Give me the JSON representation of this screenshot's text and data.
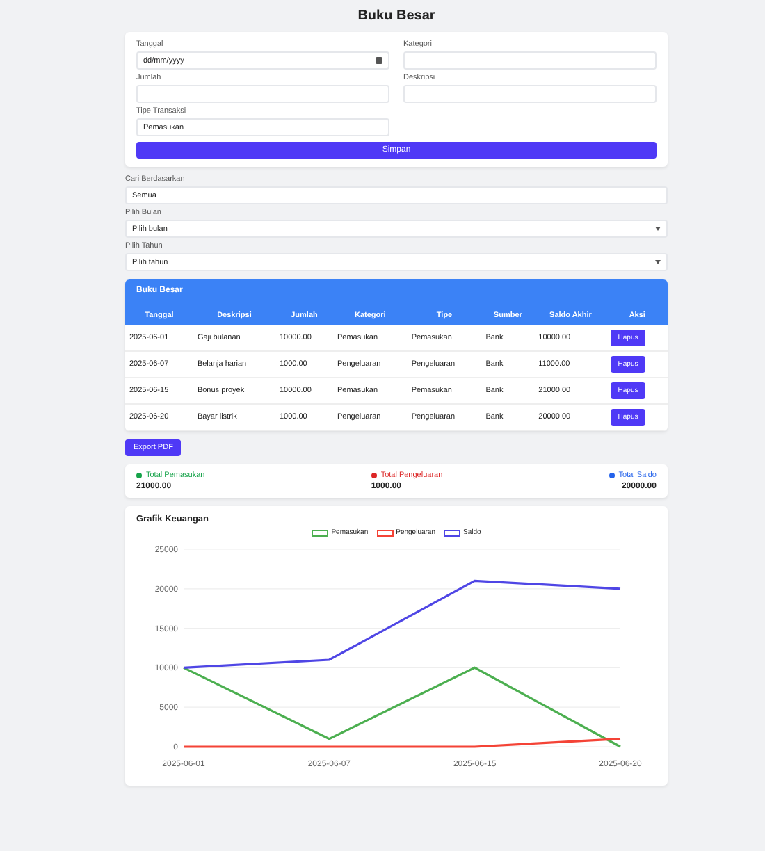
{
  "title": "Buku Besar",
  "form": {
    "fields": [
      {
        "label": "Tanggal",
        "value": "dd/mm/yyyy",
        "kind": "date"
      },
      {
        "label": "Kategori",
        "kind": "text"
      },
      {
        "label": "Jumlah",
        "kind": "text"
      },
      {
        "label": "Deskripsi",
        "kind": "text"
      },
      {
        "label": "Tipe Transaksi",
        "value": "Pemasukan",
        "kind": "select"
      }
    ],
    "submit": "Simpan"
  },
  "filters": [
    {
      "label": "Cari Berdasarkan",
      "value": "Semua",
      "kind": "text"
    },
    {
      "label": "Pilih Bulan",
      "value": "Pilih bulan",
      "kind": "select"
    },
    {
      "label": "Pilih Tahun",
      "value": "Pilih tahun",
      "kind": "select"
    }
  ],
  "ledger": {
    "title": "Buku Besar",
    "columns": [
      "Tanggal",
      "Deskripsi",
      "Jumlah",
      "Kategori",
      "Tipe",
      "Sumber",
      "Saldo Akhir",
      "Aksi"
    ],
    "rows": [
      {
        "cells": [
          "2025-06-01",
          "Gaji bulanan",
          "10000.00",
          "Pemasukan",
          "Pemasukan",
          "Bank",
          "10000.00"
        ],
        "action": "Hapus"
      },
      {
        "cells": [
          "2025-06-07",
          "Belanja harian",
          "1000.00",
          "Pengeluaran",
          "Pengeluaran",
          "Bank",
          "11000.00"
        ],
        "action": "Hapus"
      },
      {
        "cells": [
          "2025-06-15",
          "Bonus proyek",
          "10000.00",
          "Pemasukan",
          "Pemasukan",
          "Bank",
          "21000.00"
        ],
        "action": "Hapus"
      },
      {
        "cells": [
          "2025-06-20",
          "Bayar listrik",
          "1000.00",
          "Pengeluaran",
          "Pengeluaran",
          "Bank",
          "20000.00"
        ],
        "action": "Hapus"
      }
    ]
  },
  "export_button": "Export PDF",
  "totals": [
    {
      "label": "Total Pemasukan",
      "value": "21000.00",
      "color": "#16a34a"
    },
    {
      "label": "Total Pengeluaran",
      "value": "1000.00",
      "color": "#dc2626"
    },
    {
      "label": "Total Saldo",
      "value": "20000.00",
      "color": "#2563eb"
    }
  ],
  "chart": {
    "title": "Grafik Keuangan",
    "chart_data": {
      "type": "line",
      "categories": [
        "2025-06-01",
        "2025-06-07",
        "2025-06-15",
        "2025-06-20"
      ],
      "series": [
        {
          "name": "Pemasukan",
          "color": "#4caf50",
          "values": [
            10000,
            1000,
            10000,
            0
          ]
        },
        {
          "name": "Pengeluaran",
          "color": "#f44336",
          "values": [
            0,
            0,
            0,
            1000
          ]
        },
        {
          "name": "Saldo",
          "color": "#4f46e5",
          "values": [
            10000,
            11000,
            21000,
            20000
          ]
        }
      ],
      "ylim": [
        0,
        25000
      ],
      "grid": true,
      "yticks": [
        0,
        5000,
        10000,
        15000,
        20000,
        25000
      ]
    }
  }
}
